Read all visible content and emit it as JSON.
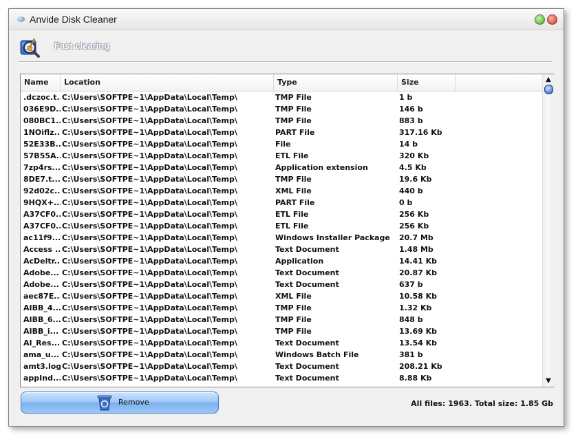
{
  "window": {
    "title": "Anvide Disk Cleaner"
  },
  "header": {
    "label": "Fast clearing",
    "icon": "magnifier-broom-icon"
  },
  "table": {
    "columns": [
      "Name",
      "Location",
      "Type",
      "Size"
    ],
    "rows": [
      [
        ".dczoc.t...",
        "C:\\Users\\SOFTPE~1\\AppData\\Local\\Temp\\",
        "TMP File",
        "1 b"
      ],
      [
        "036E9D...",
        "C:\\Users\\SOFTPE~1\\AppData\\Local\\Temp\\",
        "TMP File",
        "146 b"
      ],
      [
        "080BC1...",
        "C:\\Users\\SOFTPE~1\\AppData\\Local\\Temp\\",
        "TMP File",
        "883 b"
      ],
      [
        "1NOiflz...",
        "C:\\Users\\SOFTPE~1\\AppData\\Local\\Temp\\",
        "PART File",
        "317.16 Kb"
      ],
      [
        "52E33B...",
        "C:\\Users\\SOFTPE~1\\AppData\\Local\\Temp\\",
        "File",
        "14 b"
      ],
      [
        "57B55A...",
        "C:\\Users\\SOFTPE~1\\AppData\\Local\\Temp\\",
        "ETL File",
        "320 Kb"
      ],
      [
        "7zp4rs...",
        "C:\\Users\\SOFTPE~1\\AppData\\Local\\Temp\\",
        "Application extension",
        "4.5 Kb"
      ],
      [
        "8DE7.t...",
        "C:\\Users\\SOFTPE~1\\AppData\\Local\\Temp\\",
        "TMP File",
        "19.6 Kb"
      ],
      [
        "92d02c...",
        "C:\\Users\\SOFTPE~1\\AppData\\Local\\Temp\\",
        "XML File",
        "440 b"
      ],
      [
        "9HQX+...",
        "C:\\Users\\SOFTPE~1\\AppData\\Local\\Temp\\",
        "PART File",
        "0 b"
      ],
      [
        "A37CF0...",
        "C:\\Users\\SOFTPE~1\\AppData\\Local\\Temp\\",
        "ETL File",
        "256 Kb"
      ],
      [
        "A37CF0...",
        "C:\\Users\\SOFTPE~1\\AppData\\Local\\Temp\\",
        "ETL File",
        "256 Kb"
      ],
      [
        "ac11f9...",
        "C:\\Users\\SOFTPE~1\\AppData\\Local\\Temp\\",
        "Windows Installer Package",
        "20.7 Mb"
      ],
      [
        "Access ...",
        "C:\\Users\\SOFTPE~1\\AppData\\Local\\Temp\\",
        "Text Document",
        "1.48 Mb"
      ],
      [
        "AcDeltr...",
        "C:\\Users\\SOFTPE~1\\AppData\\Local\\Temp\\",
        "Application",
        "14.41 Kb"
      ],
      [
        "Adobe...",
        "C:\\Users\\SOFTPE~1\\AppData\\Local\\Temp\\",
        "Text Document",
        "20.87 Kb"
      ],
      [
        "Adobe...",
        "C:\\Users\\SOFTPE~1\\AppData\\Local\\Temp\\",
        "Text Document",
        "637 b"
      ],
      [
        "aec87E...",
        "C:\\Users\\SOFTPE~1\\AppData\\Local\\Temp\\",
        "XML File",
        "10.58 Kb"
      ],
      [
        "AIBB_4...",
        "C:\\Users\\SOFTPE~1\\AppData\\Local\\Temp\\",
        "TMP File",
        "1.32 Kb"
      ],
      [
        "AIBB_6...",
        "C:\\Users\\SOFTPE~1\\AppData\\Local\\Temp\\",
        "TMP File",
        "848 b"
      ],
      [
        "AIBB_i...",
        "C:\\Users\\SOFTPE~1\\AppData\\Local\\Temp\\",
        "TMP File",
        "13.69 Kb"
      ],
      [
        "AI_Res...",
        "C:\\Users\\SOFTPE~1\\AppData\\Local\\Temp\\",
        "Text Document",
        "13.54 Kb"
      ],
      [
        "ama_u...",
        "C:\\Users\\SOFTPE~1\\AppData\\Local\\Temp\\",
        "Windows Batch File",
        "381 b"
      ],
      [
        "amt3.log",
        "C:\\Users\\SOFTPE~1\\AppData\\Local\\Temp\\",
        "Text Document",
        "208.21 Kb"
      ],
      [
        "appInd...",
        "C:\\Users\\SOFTPE~1\\AppData\\Local\\Temp\\",
        "Text Document",
        "8.88 Kb"
      ]
    ]
  },
  "footer": {
    "remove_label": "Remove",
    "status": "All files: 1963. Total size: 1.85 Gb"
  },
  "colors": {
    "accent": "#7bb0ee",
    "close": "#d12a18",
    "minimize": "#3da322"
  }
}
